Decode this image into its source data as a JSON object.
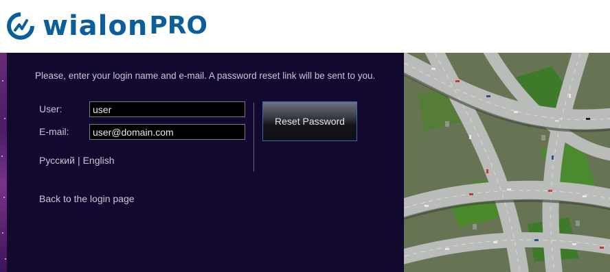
{
  "logo": {
    "word": "wialon",
    "suffix": "PRO"
  },
  "form": {
    "instructions": "Please, enter your login name and e-mail. A password reset link will be sent to you.",
    "user_label": "User:",
    "user_value": "user",
    "email_label": "E-mail:",
    "email_value": "user@domain.com",
    "reset_button": "Reset Password"
  },
  "languages": {
    "russian": "Русский",
    "separator": "|",
    "english": "English"
  },
  "back_link": "Back to the login page",
  "colors": {
    "panel_bg": "#13082e",
    "brand_blue": "#0a5f9a",
    "text": "#c9c6d6",
    "button_border": "#3f67b3"
  },
  "icons": {
    "logo_mark": "wialon-logo-icon"
  }
}
